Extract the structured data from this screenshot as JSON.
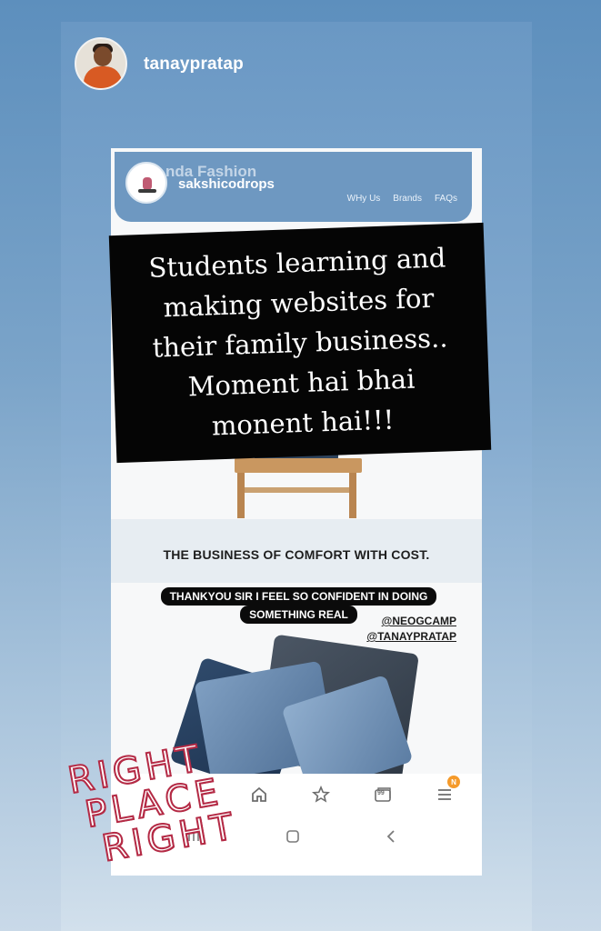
{
  "story": {
    "username": "tanaypratap"
  },
  "site": {
    "title_back": "nda Fashion",
    "title_front": "sakshicodrops",
    "nav": [
      "WHy Us",
      "Brands",
      "FAQs"
    ]
  },
  "caption": {
    "lines": [
      "Students learning and",
      "making websites for",
      "their family business..",
      "Moment hai bhai",
      "monent hai!!!"
    ]
  },
  "page": {
    "tagline": "THE BUSINESS OF COMFORT WITH COST.",
    "thanks_line_1": "THANKYOU SIR I FEEL SO CONFIDENT IN DOING",
    "thanks_line_2": "SOMETHING REAL",
    "mention_1": "@NEOGCAMP",
    "mention_2": "@TANAYPRATAP"
  },
  "browser_nav": {
    "icons": [
      "home-icon",
      "star-icon",
      "tabs-icon",
      "menu-icon"
    ],
    "tabs_count": "99",
    "menu_badge": "N"
  },
  "system_nav": {
    "icons": [
      "recents-icon",
      "home-button-icon",
      "back-icon"
    ]
  },
  "sticker": {
    "lines": [
      "RIGHT",
      "PLACE",
      "RIGHT"
    ],
    "color": "#b42a45"
  }
}
